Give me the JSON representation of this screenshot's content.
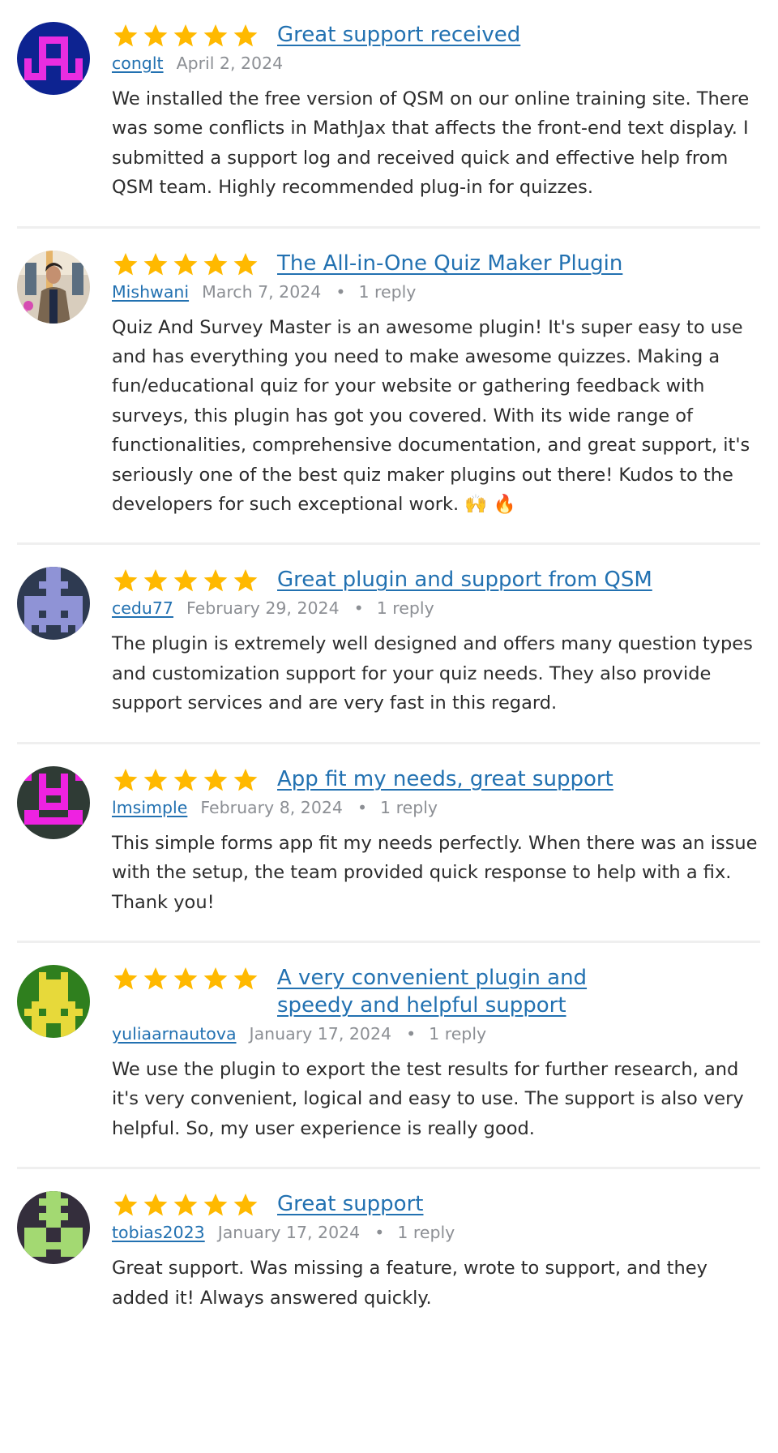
{
  "colors": {
    "star": "#ffb900",
    "link": "#2271b1",
    "meta": "#8c8f94",
    "text": "#2c2c2c",
    "divider": "#efefef"
  },
  "reviews": [
    {
      "rating": 5,
      "title": "Great support received",
      "author": "conglt",
      "date": "April 2, 2024",
      "replies": "",
      "avatar": {
        "type": "identicon",
        "bg": "#0d2391",
        "fg": "#e92de0"
      },
      "body": "We installed the free version of QSM on our online training site. There was some conflicts in MathJax that affects the front-end text display. I submitted a support log and received quick and effective help from QSM team. Highly recommended plug-in for quizzes."
    },
    {
      "rating": 5,
      "title": "The All-in-One Quiz Maker Plugin",
      "author": "Mishwani",
      "date": "March 7, 2024",
      "replies": "1 reply",
      "avatar": {
        "type": "photo",
        "bg": "#c9b9a3",
        "fg": "#6b5a47"
      },
      "body": "Quiz And Survey Master is an awesome plugin! It's super easy to use and has everything you need to make awesome quizzes. Making a fun/educational quiz for your website or gathering feedback with surveys, this plugin has got you covered. With its wide range of functionalities, comprehensive documentation, and great support, it's seriously one of the best quiz maker plugins out there! Kudos to the developers for such exceptional work. 🙌 🔥"
    },
    {
      "rating": 5,
      "title": "Great plugin and support from QSM",
      "author": "cedu77",
      "date": "February 29, 2024",
      "replies": "1 reply",
      "avatar": {
        "type": "identicon",
        "bg": "#2e3a51",
        "fg": "#8f93d6"
      },
      "body": "The plugin is extremely well designed and offers many question types and customization support for your quiz needs. They also provide support services and are very fast in this regard."
    },
    {
      "rating": 5,
      "title": "App fit my needs, great support",
      "author": "lmsimple",
      "date": "February 8, 2024",
      "replies": "1 reply",
      "avatar": {
        "type": "identicon",
        "bg": "#2f3b35",
        "fg": "#ee22e1"
      },
      "body": "This simple forms app fit my needs perfectly. When there was an issue with the setup, the team provided quick response to help with a fix. Thank you!"
    },
    {
      "rating": 5,
      "title": "A very convenient plugin and speedy and helpful support",
      "author": "yuliaarnautova",
      "date": "January 17, 2024",
      "replies": "1 reply",
      "avatar": {
        "type": "identicon",
        "bg": "#2f7f1e",
        "fg": "#e7d93a"
      },
      "body": "We use the plugin to export the test results for further research, and it's very convenient, logical and easy to use. The support is also very helpful. So, my user experience is really good."
    },
    {
      "rating": 5,
      "title": "Great support",
      "author": "tobias2023",
      "date": "January 17, 2024",
      "replies": "1 reply",
      "avatar": {
        "type": "identicon",
        "bg": "#342e3c",
        "fg": "#a3d972"
      },
      "body": "Great support. Was missing a feature, wrote to support, and they added it! Always answered quickly."
    }
  ]
}
